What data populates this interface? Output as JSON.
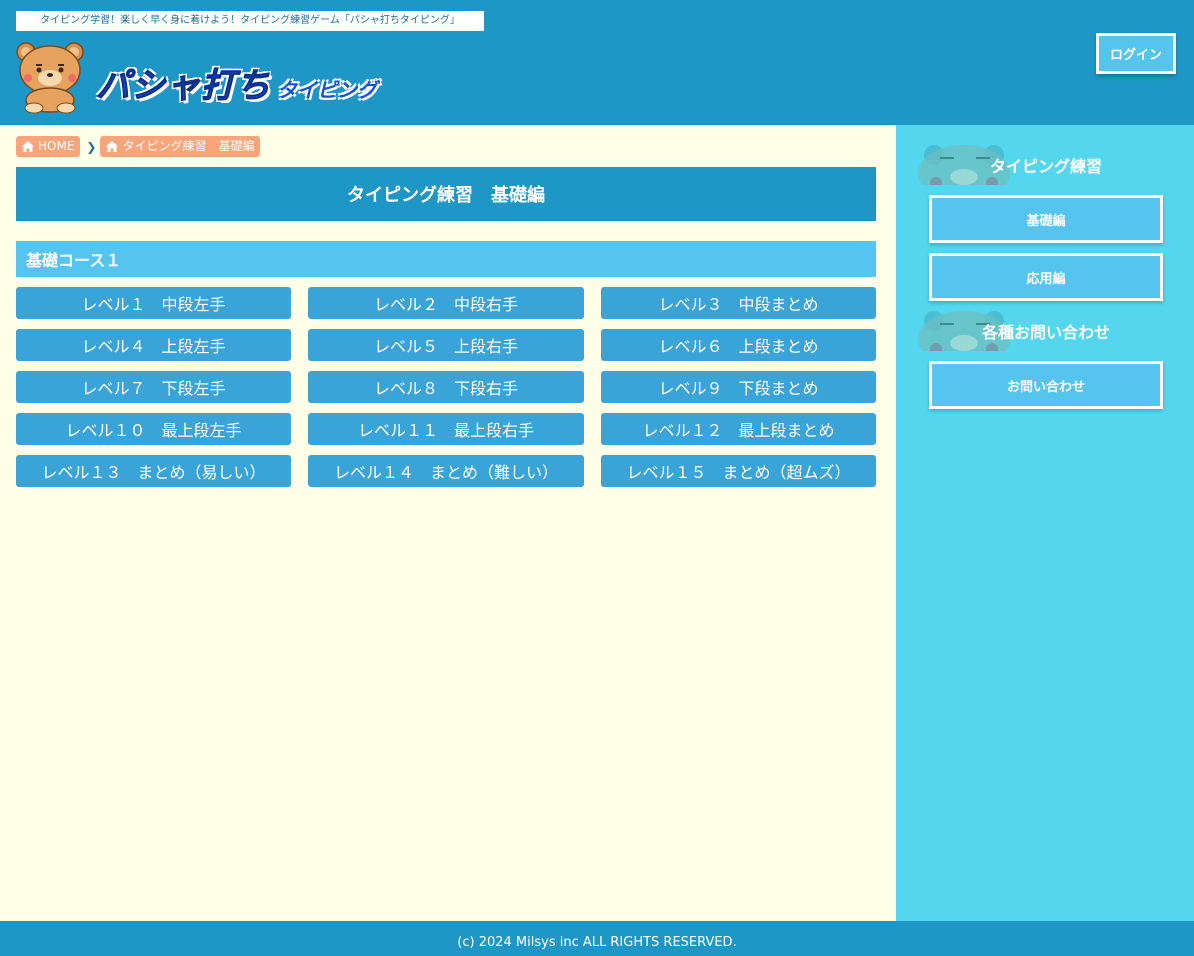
{
  "header": {
    "tagline": "タイピング学習！楽しく早く身に着けよう！タイピング練習ゲーム「パシャ打ちタイピング」",
    "logo_main": "パシャ打ち",
    "logo_sub": "タイピング",
    "login_label": "ログイン"
  },
  "breadcrumb": {
    "items": [
      {
        "label": "HOME",
        "icon": "home-icon"
      },
      {
        "label": "タイピング練習　基礎編",
        "icon": "home-icon"
      }
    ]
  },
  "main": {
    "page_title": "タイピング練習　基礎編",
    "section_title": "基礎コース１",
    "levels": [
      "レベル１　中段左手",
      "レベル２　中段右手",
      "レベル３　中段まとめ",
      "レベル４　上段左手",
      "レベル５　上段右手",
      "レベル６　上段まとめ",
      "レベル７　下段左手",
      "レベル８　下段右手",
      "レベル９　下段まとめ",
      "レベル１０　最上段左手",
      "レベル１１　最上段右手",
      "レベル１２　最上段まとめ",
      "レベル１３　まとめ（易しい）",
      "レベル１４　まとめ（難しい）",
      "レベル１５　まとめ（超ムズ）"
    ]
  },
  "sidebar": {
    "section1_title": "タイピング練習",
    "section1_items": [
      "基礎編",
      "応用編"
    ],
    "section2_title": "各種お問い合わせ",
    "section2_items": [
      "お問い合わせ"
    ]
  },
  "footer": {
    "copyright": "(c) 2024 Milsys inc ALL RIGHTS RESERVED."
  },
  "colors": {
    "header_bg": "#1f97c6",
    "main_bg": "#fffee6",
    "sidebar_bg": "#55d6ef",
    "button_blue": "#3aa3d8",
    "accent_light": "#55c5ef",
    "breadcrumb_bg": "#f9a57c"
  }
}
